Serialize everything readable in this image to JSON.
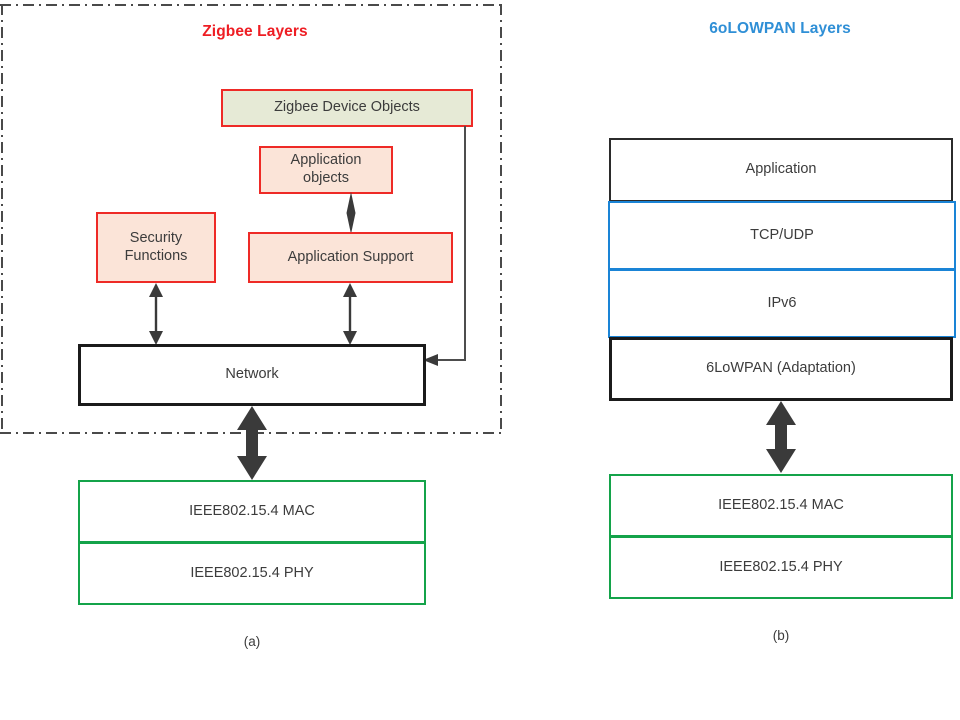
{
  "figure": {
    "panels": [
      {
        "id": "a",
        "title": "Zigbee Layers",
        "title_color": "#ee1d23",
        "caption": "(a)",
        "boundary": "dash-dot",
        "boxes": [
          {
            "key": "zdo",
            "label": "Zigbee Device Objects",
            "style": "red-border-olive-fill",
            "border_color": "#ee2a26",
            "fill": "#e6ead6"
          },
          {
            "key": "appobj",
            "label": "Application\nobjects",
            "line1": "Application",
            "line2": "objects",
            "style": "red-border-peach-fill",
            "border_color": "#ee2a26",
            "fill": "#fbe4d8"
          },
          {
            "key": "security",
            "label": "Security\nFunctions",
            "line1": "Security",
            "line2": "Functions",
            "style": "red-border-peach-fill",
            "border_color": "#ee2a26",
            "fill": "#fbe4d8"
          },
          {
            "key": "appsupport",
            "label": "Application Support",
            "style": "red-border-peach-fill",
            "border_color": "#ee2a26",
            "fill": "#fbe4d8"
          },
          {
            "key": "network",
            "label": "Network",
            "style": "thick-black-border",
            "border_color": "#1b1b1b",
            "fill": "#ffffff"
          },
          {
            "key": "mac",
            "label": "IEEE802.15.4 MAC",
            "style": "green-border",
            "border_color": "#14a34a",
            "fill": "#ffffff"
          },
          {
            "key": "phy",
            "label": "IEEE802.15.4 PHY",
            "style": "green-border",
            "border_color": "#14a34a",
            "fill": "#ffffff"
          }
        ]
      },
      {
        "id": "b",
        "title": "6oLOWPAN Layers",
        "title_color": "#2f8fd6",
        "caption": "(b)",
        "boundary": "none",
        "boxes": [
          {
            "key": "application",
            "label": "Application",
            "style": "black-border",
            "border_color": "#2b2b2b",
            "fill": "#ffffff"
          },
          {
            "key": "tcpudp",
            "label": "TCP/UDP",
            "style": "blue-border",
            "border_color": "#1a84d6",
            "fill": "#ffffff"
          },
          {
            "key": "ipv6",
            "label": "IPv6",
            "style": "blue-border",
            "border_color": "#1a84d6",
            "fill": "#ffffff"
          },
          {
            "key": "sixlowpan",
            "label": "6LoWPAN (Adaptation)",
            "style": "thick-black-border",
            "border_color": "#1b1b1b",
            "fill": "#ffffff"
          },
          {
            "key": "mac",
            "label": "IEEE802.15.4 MAC",
            "style": "green-border",
            "border_color": "#14a34a",
            "fill": "#ffffff"
          },
          {
            "key": "phy",
            "label": "IEEE802.15.4 PHY",
            "style": "green-border",
            "border_color": "#14a34a",
            "fill": "#ffffff"
          }
        ]
      }
    ],
    "connectors": [
      {
        "key": "appobj-appsupport",
        "type": "double-arrow-thin",
        "from": "appobj",
        "to": "appsupport"
      },
      {
        "key": "security-network",
        "type": "double-arrow-thin",
        "from": "security",
        "to": "network"
      },
      {
        "key": "appsupport-network",
        "type": "double-arrow-thin",
        "from": "appsupport",
        "to": "network"
      },
      {
        "key": "zdo-network",
        "type": "elbow-arrow",
        "from": "zdo",
        "to": "network"
      },
      {
        "key": "network-mac-a",
        "type": "double-arrow-thick",
        "from": "network",
        "to": "mac"
      },
      {
        "key": "sixlowpan-mac-b",
        "type": "double-arrow-thick",
        "from": "sixlowpan",
        "to": "mac"
      }
    ],
    "colors": {
      "zigbee_title": "#ee1d23",
      "lowpan_title": "#2f8fd6",
      "red_border": "#ee2a26",
      "peach_fill": "#fbe4d8",
      "olive_fill": "#e6ead6",
      "green_border": "#14a34a",
      "blue_border": "#1a84d6",
      "black_border": "#1b1b1b",
      "arrow_dark": "#3a3a3a",
      "dashdot": "#4a4a4a"
    }
  }
}
